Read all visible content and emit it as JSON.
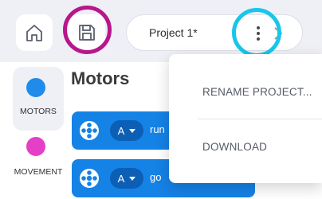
{
  "header": {
    "project_title": "Project 1*"
  },
  "sidebar": {
    "categories": [
      {
        "label": "MOTORS",
        "color": "#1f8bea",
        "selected": true
      },
      {
        "label": "MOVEMENT",
        "color": "#e53fc8",
        "selected": false
      }
    ]
  },
  "palette": {
    "title": "Motors",
    "blocks": [
      {
        "motor": "A",
        "word": "run"
      },
      {
        "motor": "A",
        "word": "go"
      }
    ]
  },
  "menu": {
    "items": [
      {
        "label": "RENAME PROJECT..."
      },
      {
        "label": "DOWNLOAD"
      }
    ]
  },
  "colors": {
    "save_highlight": "#b8168b",
    "menu_highlight": "#18c6ea",
    "motor_block": "#1582e6"
  }
}
